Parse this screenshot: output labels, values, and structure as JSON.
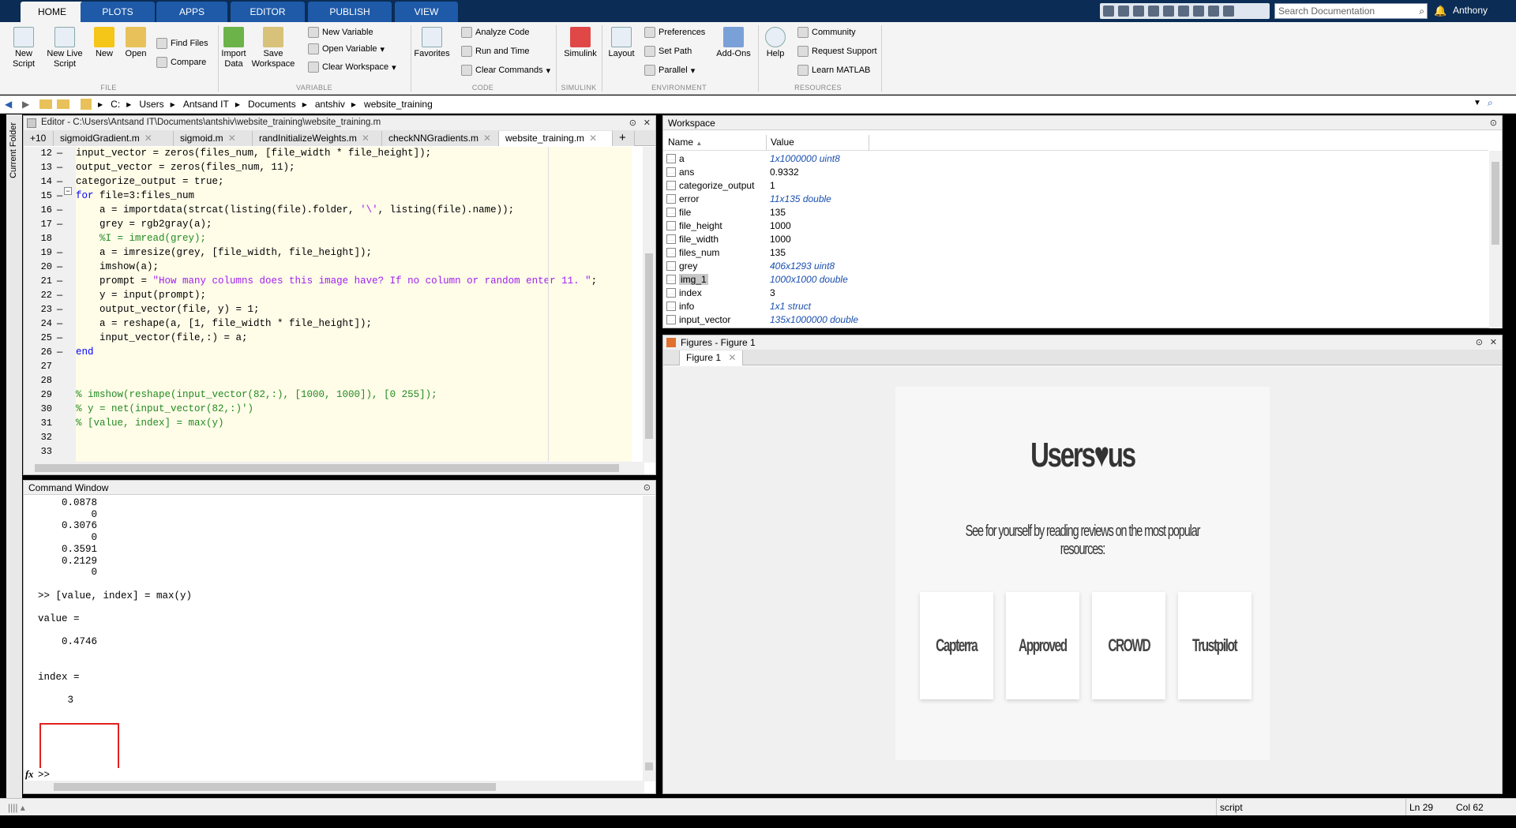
{
  "ribbon_tabs": [
    "HOME",
    "PLOTS",
    "APPS",
    "EDITOR",
    "PUBLISH",
    "VIEW"
  ],
  "search": {
    "placeholder": "Search Documentation"
  },
  "user": "Anthony",
  "ribbon": {
    "file": {
      "section": "FILE",
      "new_script": "New Script",
      "new_live_script": "New Live Script",
      "new": "New",
      "open": "Open",
      "find_files": "Find Files",
      "compare": "Compare"
    },
    "variable": {
      "section": "VARIABLE",
      "import_data": "Import Data",
      "save_workspace": "Save Workspace",
      "new_variable": "New Variable",
      "open_variable": "Open Variable",
      "clear_workspace": "Clear Workspace"
    },
    "code": {
      "section": "CODE",
      "favorites": "Favorites",
      "analyze_code": "Analyze Code",
      "run_and_time": "Run and Time",
      "clear_commands": "Clear Commands"
    },
    "simulink": {
      "section": "SIMULINK",
      "simulink": "Simulink"
    },
    "environment": {
      "section": "ENVIRONMENT",
      "layout": "Layout",
      "preferences": "Preferences",
      "set_path": "Set Path",
      "parallel": "Parallel",
      "add_ons": "Add-Ons"
    },
    "resources": {
      "section": "RESOURCES",
      "help": "Help",
      "community": "Community",
      "request_support": "Request Support",
      "learn_matlab": "Learn MATLAB"
    }
  },
  "address": {
    "crumbs": [
      "C:",
      "Users",
      "Antsand IT",
      "Documents",
      "antshiv",
      "website_training"
    ]
  },
  "left_strip": "Current Folder",
  "editor": {
    "title": "Editor - C:\\Users\\Antsand IT\\Documents\\antshiv\\website_training\\website_training.m",
    "tab_overflow": "+10",
    "tabs": [
      "sigmoidGradient.m",
      "sigmoid.m",
      "randInitializeWeights.m",
      "checkNNGradients.m",
      "website_training.m"
    ],
    "lines": [
      {
        "n": "12",
        "dash": "—",
        "parts": [
          {
            "t": "input_vector = zeros(files_num, [file_width * file_height]);",
            "c": ""
          }
        ]
      },
      {
        "n": "13",
        "dash": "—",
        "parts": [
          {
            "t": "output_vector = zeros(files_num, 11);",
            "c": ""
          }
        ]
      },
      {
        "n": "14",
        "dash": "—",
        "parts": [
          {
            "t": "categorize_output = true;",
            "c": ""
          }
        ]
      },
      {
        "n": "15",
        "dash": "—",
        "parts": [
          {
            "t": "for ",
            "c": "kw"
          },
          {
            "t": "file=3:files_num",
            "c": ""
          }
        ]
      },
      {
        "n": "16",
        "dash": "—",
        "parts": [
          {
            "t": "    a = importdata(strcat(listing(file).folder, ",
            "c": ""
          },
          {
            "t": "'\\'",
            "c": "str"
          },
          {
            "t": ", listing(file).name));",
            "c": ""
          }
        ]
      },
      {
        "n": "17",
        "dash": "—",
        "parts": [
          {
            "t": "    grey = rgb2gray(a);",
            "c": ""
          }
        ]
      },
      {
        "n": "18",
        "dash": "",
        "parts": [
          {
            "t": "    %I = imread(grey);",
            "c": "cm"
          }
        ]
      },
      {
        "n": "19",
        "dash": "—",
        "parts": [
          {
            "t": "    a = imresize(grey, [file_width, file_height]);",
            "c": ""
          }
        ]
      },
      {
        "n": "20",
        "dash": "—",
        "parts": [
          {
            "t": "    imshow(a);",
            "c": ""
          }
        ]
      },
      {
        "n": "21",
        "dash": "—",
        "parts": [
          {
            "t": "    prompt = ",
            "c": ""
          },
          {
            "t": "\"How many columns does this image have? If no column or random enter 11. \"",
            "c": "str"
          },
          {
            "t": ";",
            "c": ""
          }
        ]
      },
      {
        "n": "22",
        "dash": "—",
        "parts": [
          {
            "t": "    y = input(prompt);",
            "c": ""
          }
        ]
      },
      {
        "n": "23",
        "dash": "—",
        "parts": [
          {
            "t": "    output_vector(file, y) = 1;",
            "c": ""
          }
        ]
      },
      {
        "n": "24",
        "dash": "—",
        "parts": [
          {
            "t": "    a = reshape(a, [1, file_width * file_height]);",
            "c": ""
          }
        ]
      },
      {
        "n": "25",
        "dash": "—",
        "parts": [
          {
            "t": "    input_vector(file,:) = a;",
            "c": ""
          }
        ]
      },
      {
        "n": "26",
        "dash": "—",
        "parts": [
          {
            "t": "end",
            "c": "kw"
          }
        ]
      },
      {
        "n": "27",
        "dash": "",
        "parts": [
          {
            "t": "",
            "c": ""
          }
        ]
      },
      {
        "n": "28",
        "dash": "",
        "parts": [
          {
            "t": "",
            "c": ""
          }
        ]
      },
      {
        "n": "29",
        "dash": "",
        "parts": [
          {
            "t": "% imshow(reshape(input_vector(82,:), [1000, 1000]), [0 255]);",
            "c": "cm"
          }
        ]
      },
      {
        "n": "30",
        "dash": "",
        "parts": [
          {
            "t": "% y = net(input_vector(82,:)')",
            "c": "cm"
          }
        ]
      },
      {
        "n": "31",
        "dash": "",
        "parts": [
          {
            "t": "% [value, index] = max(y)",
            "c": "cm"
          }
        ]
      },
      {
        "n": "32",
        "dash": "",
        "parts": [
          {
            "t": "",
            "c": ""
          }
        ]
      },
      {
        "n": "33",
        "dash": "",
        "parts": [
          {
            "t": "",
            "c": ""
          }
        ]
      }
    ]
  },
  "command_window": {
    "title": "Command Window",
    "lines": [
      "    0.0878",
      "         0",
      "    0.3076",
      "         0",
      "    0.3591",
      "    0.2129",
      "         0",
      "",
      ">> [value, index] = max(y)",
      "",
      "value =",
      "",
      "    0.4746",
      "",
      "",
      "index =",
      "",
      "     3"
    ],
    "fx": "fx",
    "prompt": ">>"
  },
  "workspace": {
    "title": "Workspace",
    "col_name": "Name",
    "col_value": "Value",
    "rows": [
      {
        "name": "a",
        "value": "1x1000000 uint8",
        "italic": true
      },
      {
        "name": "ans",
        "value": "0.9332",
        "italic": false
      },
      {
        "name": "categorize_output",
        "value": "1",
        "italic": false
      },
      {
        "name": "error",
        "value": "11x135 double",
        "italic": true
      },
      {
        "name": "file",
        "value": "135",
        "italic": false
      },
      {
        "name": "file_height",
        "value": "1000",
        "italic": false
      },
      {
        "name": "file_width",
        "value": "1000",
        "italic": false
      },
      {
        "name": "files_num",
        "value": "135",
        "italic": false
      },
      {
        "name": "grey",
        "value": "406x1293 uint8",
        "italic": true
      },
      {
        "name": "img_1",
        "value": "1000x1000 double",
        "italic": true
      },
      {
        "name": "index",
        "value": "3",
        "italic": false
      },
      {
        "name": "info",
        "value": "1x1 struct",
        "italic": true
      },
      {
        "name": "input_vector",
        "value": "135x1000000 double",
        "italic": true
      }
    ]
  },
  "figures": {
    "title": "Figures - Figure 1",
    "tab": "Figure 1",
    "headline_left": "Users",
    "headline_heart": "♥",
    "headline_right": "us",
    "subtitle": "See for yourself by reading reviews on the most popular resources:",
    "cards": [
      "Capterra",
      "Approved",
      "CROWD",
      "Trustpilot"
    ]
  },
  "status": {
    "script": "script",
    "ln_label": "Ln",
    "ln": "29",
    "col_label": "Col",
    "col": "62"
  }
}
